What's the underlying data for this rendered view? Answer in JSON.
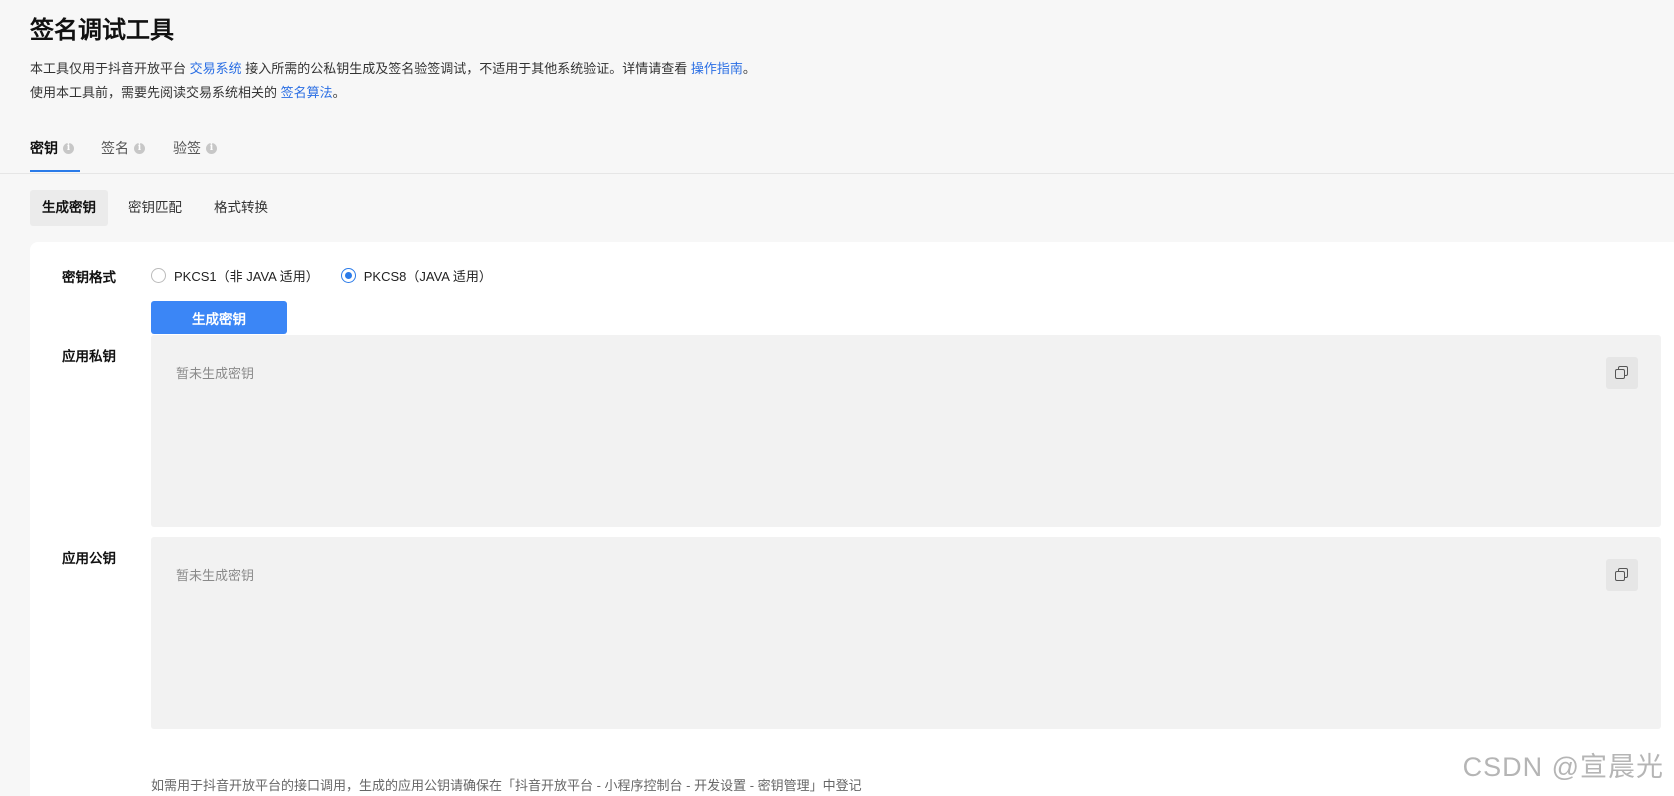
{
  "page": {
    "title": "签名调试工具",
    "desc1_prefix": "本工具仅用于抖音开放平台 ",
    "desc1_link1": "交易系统",
    "desc1_middle": " 接入所需的公私钥生成及签名验签调试，不适用于其他系统验证。详情请查看 ",
    "desc1_link2": "操作指南",
    "desc1_suffix": "。",
    "desc2_prefix": "使用本工具前，需要先阅读交易系统相关的 ",
    "desc2_link": "签名算法",
    "desc2_suffix": "。"
  },
  "tabs": [
    {
      "label": "密钥",
      "active": true
    },
    {
      "label": "签名",
      "active": false
    },
    {
      "label": "验签",
      "active": false
    }
  ],
  "tab_info_glyph": "i",
  "subtabs": [
    {
      "label": "生成密钥",
      "active": true
    },
    {
      "label": "密钥匹配",
      "active": false
    },
    {
      "label": "格式转换",
      "active": false
    }
  ],
  "form": {
    "key_format_label": "密钥格式",
    "options": [
      {
        "label": "PKCS1（非 JAVA 适用）",
        "checked": false
      },
      {
        "label": "PKCS8（JAVA 适用）",
        "checked": true
      }
    ],
    "generate_button": "生成密钥",
    "private_key_label": "应用私钥",
    "private_key_placeholder": "暂未生成密钥",
    "public_key_label": "应用公钥",
    "public_key_placeholder": "暂未生成密钥",
    "hint": "如需用于抖音开放平台的接口调用，生成的应用公钥请确保在「抖音开放平台 - 小程序控制台 - 开发设置 - 密钥管理」中登记"
  },
  "watermark": "CSDN @宣晨光",
  "colors": {
    "accent": "#3b86f6",
    "link": "#2b6fe4",
    "background": "#f7f7f7"
  }
}
